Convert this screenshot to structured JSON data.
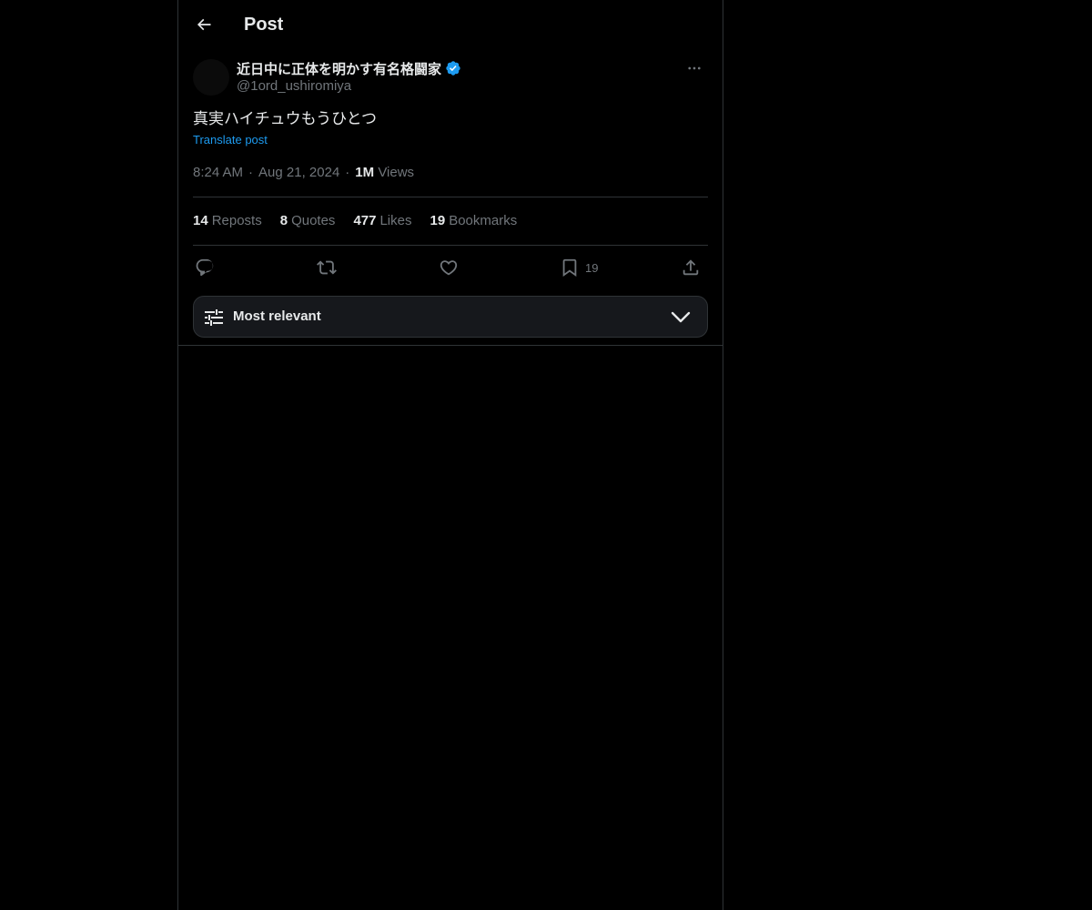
{
  "header": {
    "title": "Post",
    "back_icon": "arrow-left-icon"
  },
  "author": {
    "name": "近日中に正体を明かす有名格闘家",
    "handle": "@1ord_ushiromiya",
    "verified": true,
    "verified_color": "#1d9bf0"
  },
  "post": {
    "text": "真実ハイチュウもうひとつ",
    "translate_label": "Translate post",
    "time": "8:24 AM",
    "date": "Aug 21, 2024",
    "views_count": "1M",
    "views_label": "Views",
    "separator": "·"
  },
  "stats": {
    "reposts_count": "14",
    "reposts_label": "Reposts",
    "quotes_count": "8",
    "quotes_label": "Quotes",
    "likes_count": "477",
    "likes_label": "Likes",
    "bookmarks_count": "19",
    "bookmarks_label": "Bookmarks"
  },
  "actions": {
    "bookmark_count": "19"
  },
  "sort": {
    "label": "Most relevant"
  },
  "colors": {
    "background": "#000000",
    "text_primary": "#e7e9ea",
    "text_secondary": "#71767b",
    "link": "#1d9bf0",
    "border": "#2f3336"
  }
}
